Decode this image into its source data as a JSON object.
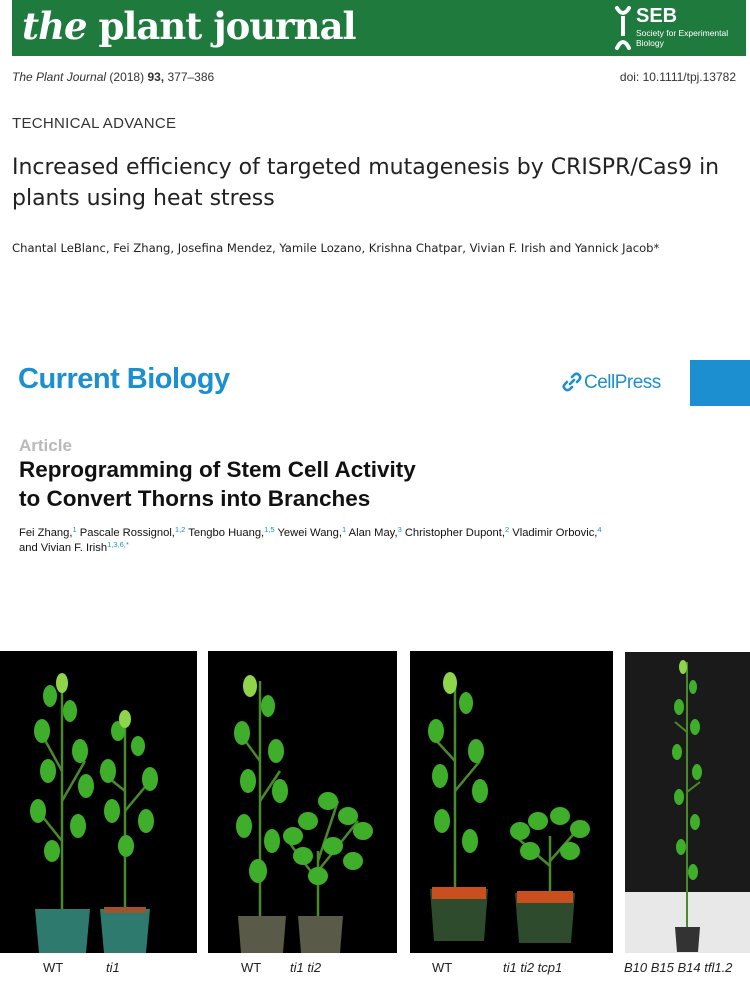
{
  "plant_journal": {
    "logo_the": "the",
    "logo_rest": "plant journal",
    "seb_name": "SEB",
    "seb_subtitle": "Society for Experimental Biology",
    "citation_journal": "The Plant Journal",
    "citation_year": "(2018)",
    "citation_volume": "93,",
    "citation_pages": "377–386",
    "doi": "doi: 10.1111/tpj.13782",
    "section": "TECHNICAL ADVANCE",
    "title": "Increased efficiency of targeted mutagenesis by CRISPR/Cas9 in plants using heat stress",
    "authors": "Chantal LeBlanc, Fei Zhang, Josefina Mendez, Yamile Lozano, Krishna Chatpar, Vivian F. Irish and Yannick Jacob*",
    "colors": {
      "banner": "#1f7a3e"
    }
  },
  "current_biology": {
    "journal": "Current Biology",
    "publisher": "CellPress",
    "article_type": "Article",
    "title_line1": "Reprogramming of Stem Cell Activity",
    "title_line2": "to Convert Thorns into Branches",
    "authors": [
      {
        "name": "Fei Zhang,",
        "sup": "1"
      },
      {
        "name": "Pascale Rossignol,",
        "sup": "1,2"
      },
      {
        "name": "Tengbo Huang,",
        "sup": "1,5"
      },
      {
        "name": "Yewei Wang,",
        "sup": "1"
      },
      {
        "name": "Alan May,",
        "sup": "3"
      },
      {
        "name": "Christopher Dupont,",
        "sup": "2"
      },
      {
        "name": "Vladimir Orbovic,",
        "sup": "4"
      }
    ],
    "authors_line2_prefix": "and Vivian F. Irish",
    "authors_line2_sup": "1,3,6,*",
    "colors": {
      "accent": "#1b8fcf"
    }
  },
  "figure": {
    "labels": [
      "WT",
      "ti1",
      "WT",
      "ti1 ti2",
      "WT",
      "ti1 ti2 tcp1",
      "B10 B15 B14 tfl1.2"
    ]
  }
}
